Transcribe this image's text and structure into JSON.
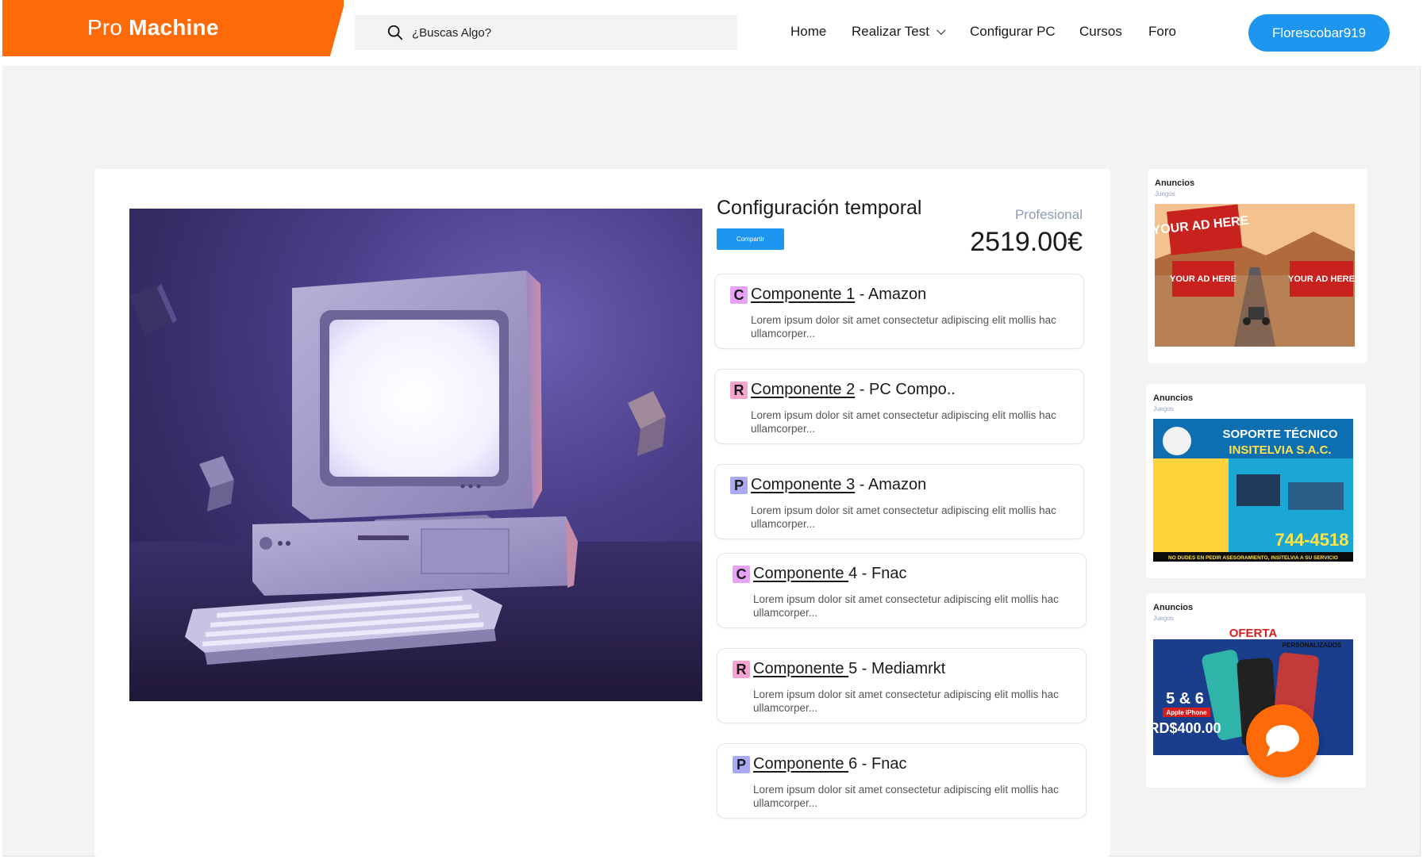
{
  "header": {
    "logo_light": "Pro",
    "logo_bold": "Machine",
    "search_placeholder": "¿Buscas Algo?",
    "nav": [
      "Home",
      "Realizar Test",
      "Configurar PC",
      "Cursos",
      "Foro"
    ],
    "user_label": "Florescobar919"
  },
  "config": {
    "title": "Configuración temporal",
    "share_label": "Compartir",
    "tier": "Profesional",
    "price": "2519.00€"
  },
  "components": [
    {
      "badge": "C",
      "badge_color": "#e7a3f5",
      "link": "Componente 1",
      "store": " - Amazon",
      "desc": "Lorem ipsum dolor sit amet consectetur adipiscing elit mollis hac ullamcorper..."
    },
    {
      "badge": "R",
      "badge_color": "#f5a3d0",
      "link": "Componente 2",
      "store": " - PC Compo..",
      "desc": "Lorem ipsum dolor sit amet consectetur adipiscing elit mollis hac ullamcorper..."
    },
    {
      "badge": "P",
      "badge_color": "#a9aaf2",
      "link": "Componente 3",
      "store": " - Amazon",
      "desc": "Lorem ipsum dolor sit amet consectetur adipiscing elit mollis hac ullamcorper..."
    },
    {
      "badge": "C",
      "badge_color": "#e7a3f5",
      "link": "Componente ",
      "store": "4 - Fnac",
      "desc": "Lorem ipsum dolor sit amet consectetur adipiscing elit mollis hac ullamcorper..."
    },
    {
      "badge": "R",
      "badge_color": "#f5a3d0",
      "link": "Componente ",
      "store": "5 - Mediamrkt",
      "desc": "Lorem ipsum dolor sit amet consectetur adipiscing elit mollis hac ullamcorper..."
    },
    {
      "badge": "P",
      "badge_color": "#a9aaf2",
      "link": "Componente ",
      "store": "6 - Fnac",
      "desc": "Lorem ipsum dolor sit amet consectetur adipiscing elit mollis hac ullamcorper..."
    }
  ],
  "ads": [
    {
      "title": "Anuncios",
      "sub": "Juegos",
      "image_text": [
        "YOUR AD HERE",
        "YOUR AD HERE",
        "YOUR AD HERE"
      ]
    },
    {
      "title": "Anuncios",
      "sub": "Juegos",
      "image_text": [
        "SOPORTE TÉCNICO",
        "INSITELVIA S.A.C.",
        "744-4518",
        "NO DUDES EN PEDIR ASESORAMIENTO, INSITELVIA A SU SERVICIO"
      ]
    },
    {
      "title": "Anuncios",
      "sub": "Juegos",
      "image_text": [
        "OFERTA",
        "PERSONALIZADOS",
        "5 & 6",
        "Apple iPhone",
        "RD$400.00"
      ]
    }
  ],
  "icons": {
    "search": "search-icon",
    "chevron": "chevron-down-icon",
    "chat": "chat-bubble-icon"
  },
  "colors": {
    "brand": "#ff6a08",
    "accent": "#1e96f0"
  }
}
